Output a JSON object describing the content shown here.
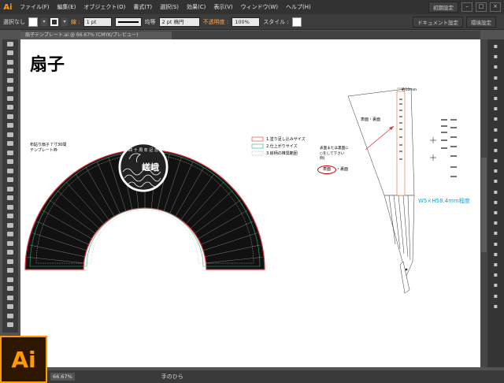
{
  "app": {
    "badge": "Ai",
    "logo": "Ai"
  },
  "menu": [
    "ファイル(F)",
    "編集(E)",
    "オブジェクト(O)",
    "書式(T)",
    "選択(S)",
    "効果(C)",
    "表示(V)",
    "ウィンドウ(W)",
    "ヘルプ(H)"
  ],
  "workspace": {
    "label": "初期設定"
  },
  "window_controls": [
    "–",
    "□",
    "×"
  ],
  "control": {
    "selection": "選択なし",
    "stroke_label": "線 :",
    "stroke_weight": "1 pt",
    "line_style": "均等",
    "brush": "2 pt 楕円",
    "opacity_label": "不透明度 :",
    "opacity_value": "100%",
    "style_label": "スタイル :",
    "doc_setup": "ドキュメント設定",
    "prefs": "環境設定"
  },
  "document": {
    "tab": "扇子テンプレート.ai @ 66.67% (CMYK/プレビュー)"
  },
  "artboard": {
    "title": "扇子",
    "fan_note_1": "布貼り扇子７寸30間",
    "fan_note_2": "テンプレート枠",
    "legend": [
      {
        "label": "1.塗り足し込みサイズ",
        "color": "#e0303a"
      },
      {
        "label": "2.仕上がりサイズ",
        "color": "#2eb27e"
      },
      {
        "label": "3.絵柄の推奨範囲",
        "color": "#888888"
      }
    ],
    "face_note": "表面・裏面",
    "sides_note_1": "表面または裏面に",
    "sides_note_2": "○をして下さい",
    "sides_note_3": "例)",
    "sides_front": "表面",
    "sides_back": "・裏面",
    "size_note": "W5×H58.4mm程度",
    "dim_note": "約10mm",
    "stick_text": "四十周年記念 すなっく 嵯峨"
  },
  "status": {
    "zoom": "66.67%",
    "tool_hint": "手のひら"
  },
  "tools": [
    "selection",
    "direct-selection",
    "magic-wand",
    "lasso",
    "pen",
    "type",
    "line",
    "rectangle",
    "paintbrush",
    "pencil",
    "blob-brush",
    "eraser",
    "rotate",
    "scale",
    "width",
    "free-transform",
    "shape-builder",
    "perspective",
    "mesh",
    "gradient",
    "eyedropper",
    "blend",
    "symbol-sprayer",
    "column-graph",
    "artboard",
    "slice",
    "hand",
    "zoom",
    "fill-stroke",
    "swap",
    "draw-mode",
    "screen-mode"
  ],
  "panels": [
    "color",
    "color-guide",
    "swatches",
    "brushes",
    "symbols",
    "stroke",
    "gradient",
    "transparency",
    "appearance",
    "graphic-styles",
    "layers",
    "artboards",
    "align",
    "transform",
    "pathfinder",
    "character",
    "paragraph",
    "opentype",
    "links",
    "actions",
    "navigator",
    "info",
    "attributes",
    "document-info",
    "image-trace",
    "cc-libraries"
  ]
}
